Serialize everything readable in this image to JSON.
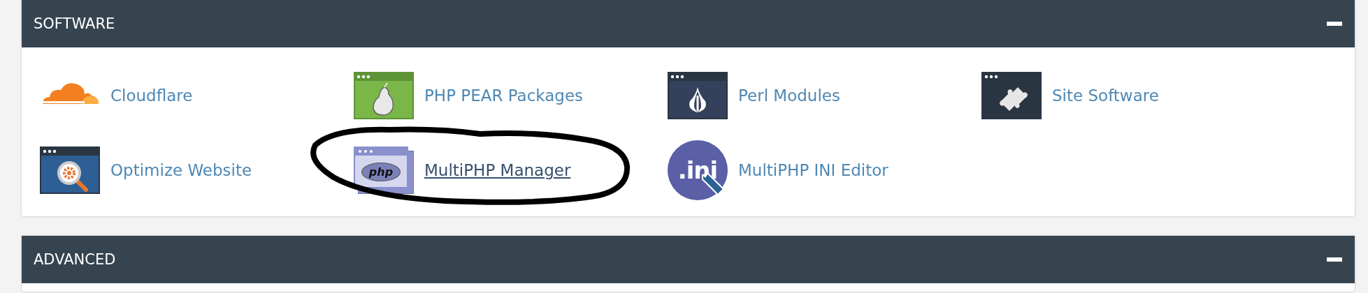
{
  "sections": [
    {
      "title": "SOFTWARE",
      "expanded": true,
      "items": [
        {
          "label": "Cloudflare",
          "kind": "cloud",
          "hovered": false
        },
        {
          "label": "PHP PEAR Packages",
          "kind": "pear",
          "hovered": false
        },
        {
          "label": "Perl Modules",
          "kind": "onion",
          "hovered": false
        },
        {
          "label": "Site Software",
          "kind": "puzzle",
          "hovered": false
        },
        {
          "label": "Optimize Website",
          "kind": "optimize",
          "hovered": false
        },
        {
          "label": "MultiPHP Manager",
          "kind": "php",
          "icon_text": "php",
          "hovered": true,
          "circled": true
        },
        {
          "label": "MultiPHP INI Editor",
          "kind": "ini",
          "icon_text": ".ini",
          "hovered": false
        }
      ]
    },
    {
      "title": "ADVANCED",
      "expanded": true
    }
  ]
}
